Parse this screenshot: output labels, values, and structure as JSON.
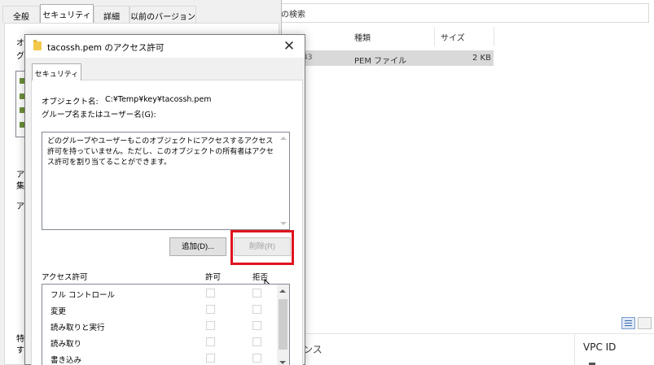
{
  "explorer": {
    "search_fragment": "の検索",
    "columns": [
      "種類",
      "サイズ"
    ],
    "file_row": {
      "name_fragment": "43",
      "type": "PEM ファイル",
      "size": "2 KB"
    },
    "bottom_fragment": "ンス",
    "bottom_column": "VPC ID"
  },
  "properties": {
    "tabs": [
      "全般",
      "セキュリティ",
      "詳細",
      "以前のバージョン"
    ],
    "active_tab": "セキュリティ",
    "label_fragments": [
      "オ",
      "グ",
      "ア",
      "集",
      "ア",
      "特",
      "す"
    ]
  },
  "dialog": {
    "title": "tacossh.pem のアクセス許可",
    "tab": "セキュリティ",
    "object_label": "オブジェクト名:",
    "object_value": "C:¥Temp¥key¥tacossh.pem",
    "group_label": "グループ名またはユーザー名(G):",
    "message": "どのグループやユーザーもこのオブジェクトにアクセスするアクセス許可を持っていません。ただし、このオブジェクトの所有者はアクセス許可を割り当てることができます。",
    "add_button": "追加(D)...",
    "remove_button": "削除(R)",
    "permissions": {
      "header": "アクセス許可",
      "allow": "許可",
      "deny": "拒否",
      "items": [
        {
          "name": "フル コントロール"
        },
        {
          "name": "変更"
        },
        {
          "name": "読み取りと実行"
        },
        {
          "name": "読み取り"
        },
        {
          "name": "書き込み"
        }
      ]
    }
  },
  "colors": {
    "highlight": "#e0141e",
    "selected_row": "#d9d9d9",
    "dialog_bg": "#f0f0f0"
  }
}
